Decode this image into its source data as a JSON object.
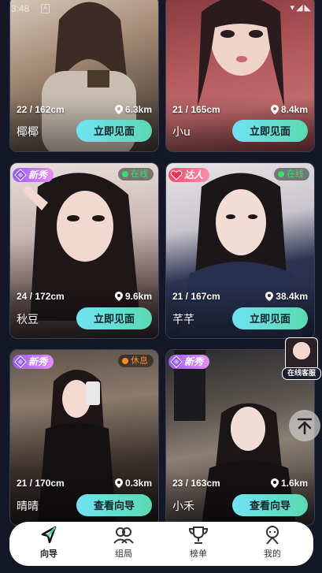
{
  "status_bar": {
    "time": "3:48",
    "indicator": "A",
    "right": "▾◢◣"
  },
  "cards": [
    {
      "age_height": "22 / 162cm",
      "distance": "6.3km",
      "name": "椰椰",
      "cta": "立即见面",
      "badge": "",
      "badge_type": "",
      "presence": "",
      "presence_color": ""
    },
    {
      "age_height": "21 / 165cm",
      "distance": "8.4km",
      "name": "小u",
      "cta": "立即见面",
      "badge": "",
      "badge_type": "",
      "presence": "",
      "presence_color": ""
    },
    {
      "age_height": "24 / 172cm",
      "distance": "9.6km",
      "name": "秋豆",
      "cta": "立即见面",
      "badge": "新秀",
      "badge_type": "new",
      "presence": "在线",
      "presence_color": "#2ee36b"
    },
    {
      "age_height": "21 / 167cm",
      "distance": "38.4km",
      "name": "芊芊",
      "cta": "立即见面",
      "badge": "达人",
      "badge_type": "talent",
      "presence": "在线",
      "presence_color": "#2ee36b"
    },
    {
      "age_height": "21 / 170cm",
      "distance": "0.3km",
      "name": "晴晴",
      "cta": "查看向导",
      "badge": "新秀",
      "badge_type": "new",
      "presence": "休息",
      "presence_color": "#ff8a1f"
    },
    {
      "age_height": "23 / 163cm",
      "distance": "1.6km",
      "name": "小禾",
      "cta": "查看向导",
      "badge": "新秀",
      "badge_type": "new",
      "presence": "",
      "presence_color": "#ff8a1f"
    }
  ],
  "floating": {
    "customer_service": "在线客服"
  },
  "tabbar": {
    "items": [
      {
        "label": "向导",
        "icon": "navigation-arrow-icon",
        "active": true
      },
      {
        "label": "组局",
        "icon": "group-icon",
        "active": false
      },
      {
        "label": "榜单",
        "icon": "trophy-icon",
        "active": false
      },
      {
        "label": "我的",
        "icon": "profile-icon",
        "active": false
      }
    ]
  },
  "colors": {
    "accent_start": "#6fe3f2",
    "accent_end": "#5ad9b0",
    "background": "#141826"
  }
}
